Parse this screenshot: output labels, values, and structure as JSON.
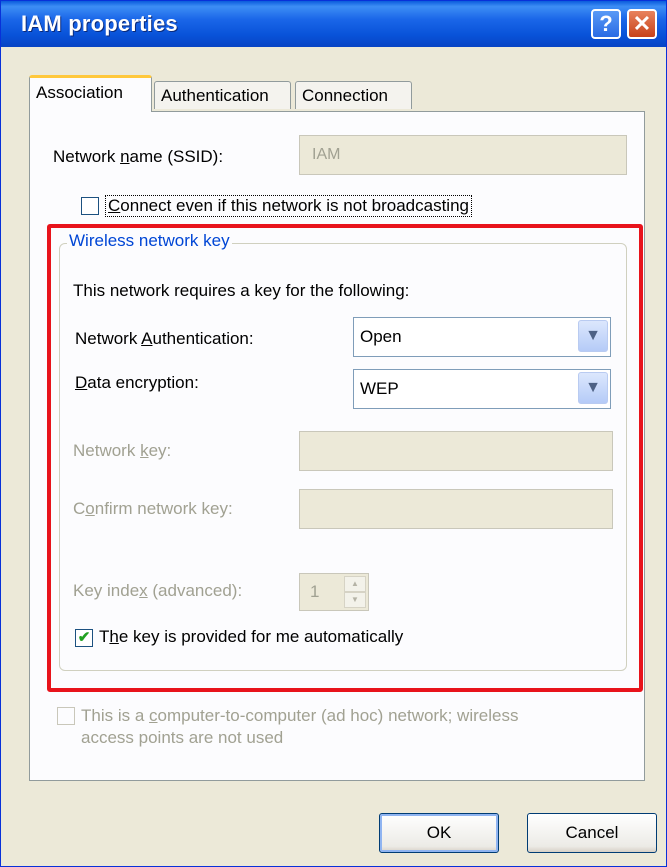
{
  "window": {
    "title": "IAM properties",
    "help_glyph": "?",
    "close_glyph": "✕"
  },
  "tabs": [
    {
      "label": "Association",
      "active": true
    },
    {
      "label": "Authentication",
      "active": false
    },
    {
      "label": "Connection",
      "active": false
    }
  ],
  "association": {
    "ssid_label": "Network name (SSID):",
    "ssid_value": "IAM",
    "connect_nonbroadcast_label": "Connect even if this network is not broadcasting",
    "connect_nonbroadcast_checked": false
  },
  "wireless_key": {
    "group_title": "Wireless network key",
    "intro": "This network requires a key for the following:",
    "auth_label": "Network Authentication:",
    "auth_value": "Open",
    "encryption_label": "Data encryption:",
    "encryption_value": "WEP",
    "network_key_label": "Network key:",
    "network_key_value": "",
    "confirm_key_label": "Confirm network key:",
    "confirm_key_value": "",
    "key_index_label": "Key index (advanced):",
    "key_index_value": "1",
    "auto_key_label": "The key is provided for me automatically",
    "auto_key_checked": true,
    "check_glyph": "✔"
  },
  "adhoc": {
    "label_line1": "This is a computer-to-computer (ad hoc) network; wireless",
    "label_line2": "access points are not used",
    "checked": false
  },
  "buttons": {
    "ok": "OK",
    "cancel": "Cancel"
  },
  "colors": {
    "highlight": "#e8131b",
    "group_title": "#0046d5",
    "titlebar": "#0852d8"
  }
}
